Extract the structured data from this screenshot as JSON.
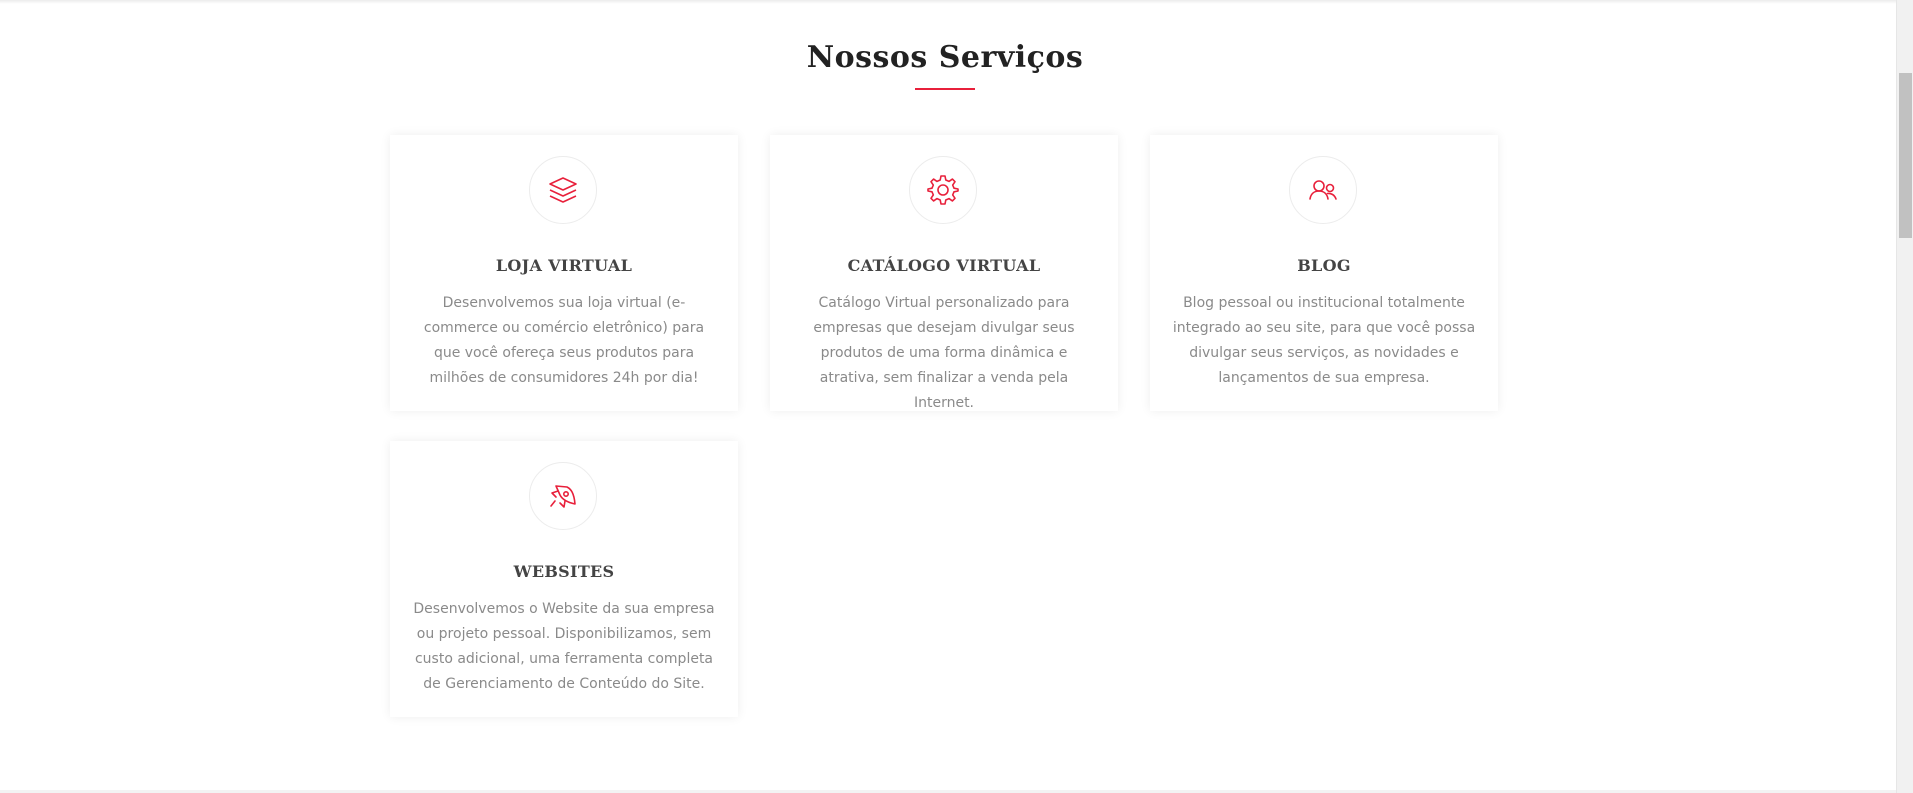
{
  "section": {
    "title": "Nossos Serviços"
  },
  "colors": {
    "accent": "#e8203b",
    "heading": "#222222",
    "text": "#8a8a8a"
  },
  "services": [
    {
      "icon": "layers-icon",
      "title": "LOJA VIRTUAL",
      "text": "Desenvolvemos sua loja virtual (e-commerce ou comércio eletrônico) para que você ofereça seus produtos para milhões de consumidores 24h por dia!"
    },
    {
      "icon": "gear-icon",
      "title": "CATÁLOGO VIRTUAL",
      "text": "Catálogo Virtual personalizado para empresas que desejam divulgar seus produtos de uma forma dinâmica e atrativa, sem finalizar a venda pela Internet."
    },
    {
      "icon": "users-icon",
      "title": "BLOG",
      "text": "Blog pessoal ou institucional totalmente integrado ao seu site, para que você possa divulgar seus serviços, as novidades e lançamentos de sua empresa."
    },
    {
      "icon": "rocket-icon",
      "title": "WEBSITES",
      "text": "Desenvolvemos o Website da sua empresa ou projeto pessoal. Disponibilizamos, sem custo adicional, uma ferramenta completa de Gerenciamento de Conteúdo do Site."
    }
  ]
}
